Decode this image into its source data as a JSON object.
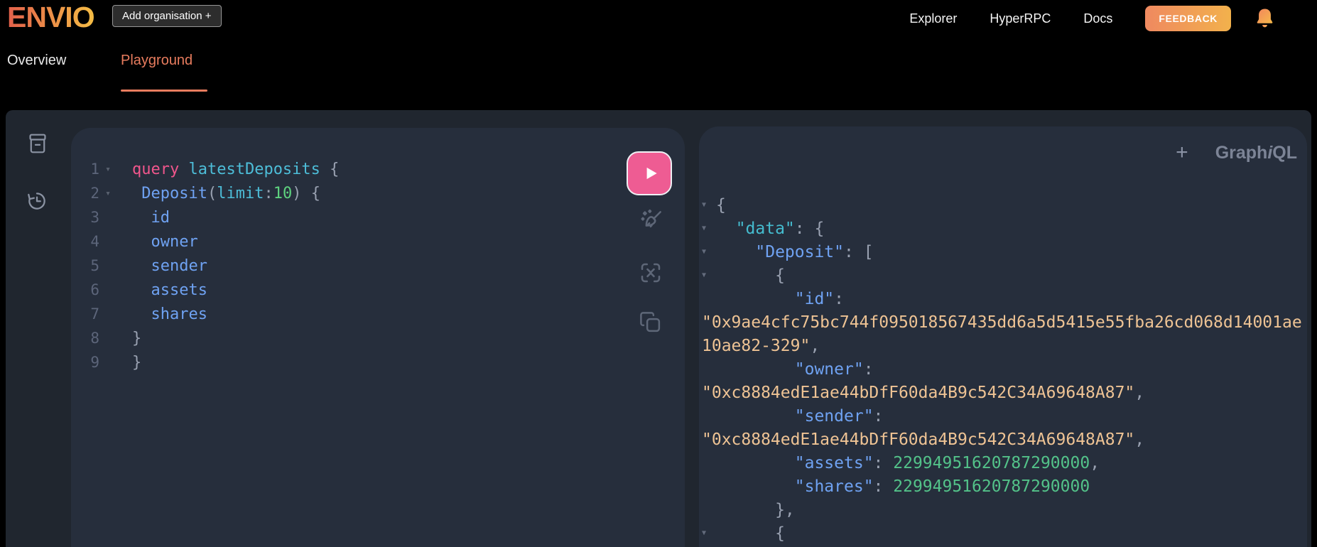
{
  "header": {
    "logo_text": "ENVIO",
    "add_organisation_label": "Add organisation +",
    "nav_links": [
      "Explorer",
      "HyperRPC",
      "Docs"
    ],
    "feedback_label": "FEEDBACK",
    "bell_icon": "notification-bell",
    "brand_gradient": [
      "#e3604b",
      "#f5bd45"
    ],
    "feedback_gradient": [
      "#ef8960",
      "#f2b14c"
    ]
  },
  "tabs": {
    "overview_label": "Overview",
    "playground_label": "Playground",
    "active_tab": "Playground",
    "accent_color": "#e87c5e"
  },
  "playground": {
    "session_header": {
      "plus": "+",
      "logo_graph": "Graph",
      "logo_i": "i",
      "logo_ql": "QL"
    },
    "editor_fold_glyph": "▾",
    "response_fold_glyph": "▼",
    "execute_button_color": "#ee5c93",
    "panel_color": "#262e3c",
    "container_color": "#20262f",
    "toolbar_icons": [
      "execute-play",
      "prettify",
      "merge-fragments",
      "copy-query"
    ],
    "sidebar_icons": [
      "docs",
      "history"
    ],
    "token_colors": {
      "kw": "#f0568c",
      "def": "#4dbdd8",
      "attr": "#4dbdd8",
      "prop": "#6fa2f2",
      "num": "#5ed37f",
      "p": "#99a1b1",
      "key": "#6fa2f2",
      "data": "#45bccf",
      "str": "#eec394",
      "numr": "#53c289"
    },
    "editor": {
      "lines": [
        {
          "num": "1",
          "fold": true,
          "tokens": [
            {
              "t": "query",
              "c": "kw"
            },
            {
              "t": " ",
              "c": "p"
            },
            {
              "t": "latestDeposits",
              "c": "def"
            },
            {
              "t": " {",
              "c": "p"
            }
          ]
        },
        {
          "num": "2",
          "fold": true,
          "tokens": [
            {
              "t": " ",
              "c": "p"
            },
            {
              "t": "Deposit",
              "c": "prop"
            },
            {
              "t": "(",
              "c": "p"
            },
            {
              "t": "limit",
              "c": "attr"
            },
            {
              "t": ":",
              "c": "p"
            },
            {
              "t": "10",
              "c": "num"
            },
            {
              "t": ")",
              "c": "p"
            },
            {
              "t": " {",
              "c": "p"
            }
          ]
        },
        {
          "num": "3",
          "fold": false,
          "tokens": [
            {
              "t": "  ",
              "c": "p"
            },
            {
              "t": "id",
              "c": "prop"
            }
          ]
        },
        {
          "num": "4",
          "fold": false,
          "tokens": [
            {
              "t": "  ",
              "c": "p"
            },
            {
              "t": "owner",
              "c": "prop"
            }
          ]
        },
        {
          "num": "5",
          "fold": false,
          "tokens": [
            {
              "t": "  ",
              "c": "p"
            },
            {
              "t": "sender",
              "c": "prop"
            }
          ]
        },
        {
          "num": "6",
          "fold": false,
          "tokens": [
            {
              "t": "  ",
              "c": "p"
            },
            {
              "t": "assets",
              "c": "prop"
            }
          ]
        },
        {
          "num": "7",
          "fold": false,
          "tokens": [
            {
              "t": "  ",
              "c": "p"
            },
            {
              "t": "shares",
              "c": "prop"
            }
          ]
        },
        {
          "num": "8",
          "fold": false,
          "tokens": [
            {
              "t": "}",
              "c": "p"
            }
          ]
        },
        {
          "num": "9",
          "fold": false,
          "tokens": [
            {
              "t": "}",
              "c": "p"
            }
          ]
        }
      ]
    },
    "response": {
      "lines": [
        {
          "fold": true,
          "indent": 0,
          "tokens": [
            {
              "t": "{",
              "c": "p"
            }
          ]
        },
        {
          "fold": true,
          "indent": 2,
          "tokens": [
            {
              "t": "\"data\"",
              "c": "data"
            },
            {
              "t": ": {",
              "c": "p"
            }
          ]
        },
        {
          "fold": true,
          "indent": 4,
          "tokens": [
            {
              "t": "\"Deposit\"",
              "c": "key"
            },
            {
              "t": ": [",
              "c": "p"
            }
          ]
        },
        {
          "fold": true,
          "indent": 6,
          "tokens": [
            {
              "t": "{",
              "c": "p"
            }
          ]
        },
        {
          "fold": false,
          "indent": 8,
          "tokens": [
            {
              "t": "\"id\"",
              "c": "key"
            },
            {
              "t": ":",
              "c": "p"
            }
          ]
        },
        {
          "fold": false,
          "wrap": true,
          "indent": 0,
          "tokens": [
            {
              "t": "\"0x9ae4cfc75bc744f095018567435dd6a5d5415e55fba26cd068d14001ae",
              "c": "str"
            }
          ]
        },
        {
          "fold": false,
          "wrap": true,
          "indent": 0,
          "tokens": [
            {
              "t": "10ae82-329\"",
              "c": "str"
            },
            {
              "t": ",",
              "c": "p"
            }
          ]
        },
        {
          "fold": false,
          "indent": 8,
          "tokens": [
            {
              "t": "\"owner\"",
              "c": "key"
            },
            {
              "t": ":",
              "c": "p"
            }
          ]
        },
        {
          "fold": false,
          "wrap": true,
          "indent": 0,
          "tokens": [
            {
              "t": "\"0xc8884edE1ae44bDfF60da4B9c542C34A69648A87\"",
              "c": "str"
            },
            {
              "t": ",",
              "c": "p"
            }
          ]
        },
        {
          "fold": false,
          "indent": 8,
          "tokens": [
            {
              "t": "\"sender\"",
              "c": "key"
            },
            {
              "t": ":",
              "c": "p"
            }
          ]
        },
        {
          "fold": false,
          "wrap": true,
          "indent": 0,
          "tokens": [
            {
              "t": "\"0xc8884edE1ae44bDfF60da4B9c542C34A69648A87\"",
              "c": "str"
            },
            {
              "t": ",",
              "c": "p"
            }
          ]
        },
        {
          "fold": false,
          "indent": 8,
          "tokens": [
            {
              "t": "\"assets\"",
              "c": "key"
            },
            {
              "t": ": ",
              "c": "p"
            },
            {
              "t": "22994951620787290000",
              "c": "numr"
            },
            {
              "t": ",",
              "c": "p"
            }
          ]
        },
        {
          "fold": false,
          "indent": 8,
          "tokens": [
            {
              "t": "\"shares\"",
              "c": "key"
            },
            {
              "t": ": ",
              "c": "p"
            },
            {
              "t": "22994951620787290000",
              "c": "numr"
            }
          ]
        },
        {
          "fold": false,
          "indent": 6,
          "tokens": [
            {
              "t": "},",
              "c": "p"
            }
          ]
        },
        {
          "fold": true,
          "indent": 6,
          "tokens": [
            {
              "t": "{",
              "c": "p"
            }
          ]
        }
      ]
    }
  }
}
